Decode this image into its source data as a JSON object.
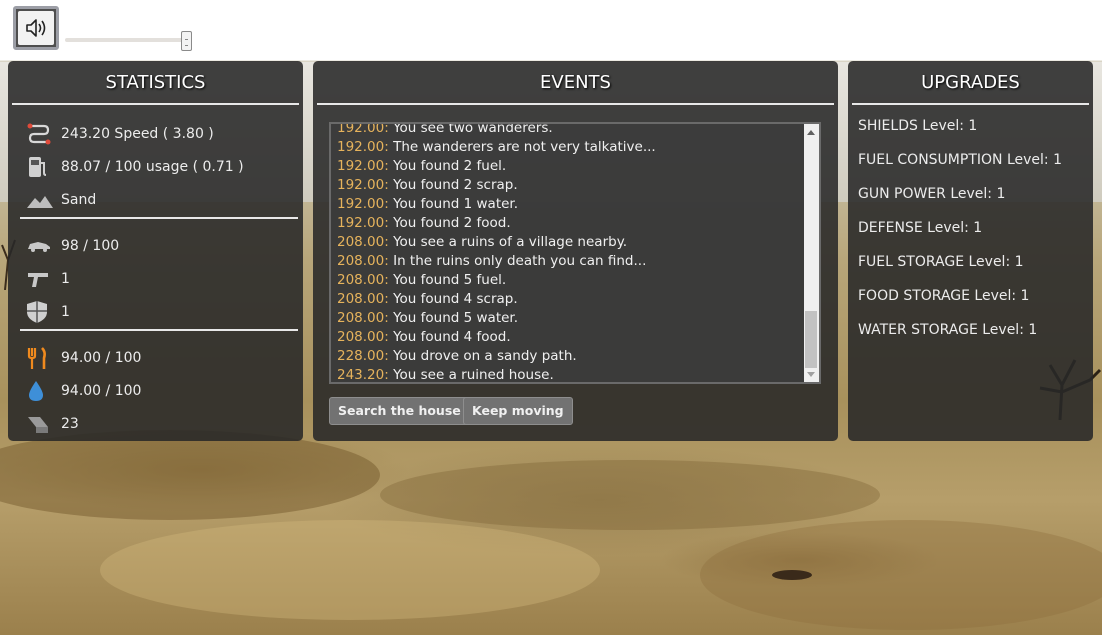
{
  "volume": {
    "level": 1.0
  },
  "statistics": {
    "title": "STATISTICS",
    "rows": [
      {
        "icon": "route-icon",
        "text": "243.20 Speed ( 3.80 )"
      },
      {
        "icon": "fuel-pump-icon",
        "text": "88.07 / 100 usage ( 0.71 )"
      },
      {
        "icon": "terrain-icon",
        "text": "Sand"
      },
      {
        "icon": "car-icon",
        "text": "98 / 100"
      },
      {
        "icon": "gun-icon",
        "text": "1"
      },
      {
        "icon": "shield-icon",
        "text": "1"
      },
      {
        "icon": "food-icon",
        "text": "94.00 / 100"
      },
      {
        "icon": "water-drop-icon",
        "text": "94.00 / 100"
      },
      {
        "icon": "scrap-icon",
        "text": "23"
      }
    ]
  },
  "events": {
    "title": "EVENTS",
    "log": [
      {
        "time": "192.00:",
        "msg": " You see two wanderers."
      },
      {
        "time": "192.00:",
        "msg": " The wanderers are not very talkative..."
      },
      {
        "time": "192.00:",
        "msg": " You found 2 fuel."
      },
      {
        "time": "192.00:",
        "msg": " You found 2 scrap."
      },
      {
        "time": "192.00:",
        "msg": " You found 1 water."
      },
      {
        "time": "192.00:",
        "msg": " You found 2 food."
      },
      {
        "time": "208.00:",
        "msg": " You see a ruins of a village nearby."
      },
      {
        "time": "208.00:",
        "msg": " In the ruins only death you can find..."
      },
      {
        "time": "208.00:",
        "msg": " You found 5 fuel."
      },
      {
        "time": "208.00:",
        "msg": " You found 4 scrap."
      },
      {
        "time": "208.00:",
        "msg": " You found 5 water."
      },
      {
        "time": "208.00:",
        "msg": " You found 4 food."
      },
      {
        "time": "228.00:",
        "msg": " You drove on a sandy path."
      },
      {
        "time": "243.20:",
        "msg": " You see a ruined house."
      }
    ],
    "actions": [
      "Search the house",
      "Keep moving"
    ]
  },
  "upgrades": {
    "title": "UPGRADES",
    "items": [
      "SHIELDS Level: 1",
      "FUEL CONSUMPTION Level: 1",
      "GUN POWER Level: 1",
      "DEFENSE Level: 1",
      "FUEL STORAGE Level: 1",
      "FOOD STORAGE Level: 1",
      "WATER STORAGE Level: 1"
    ]
  }
}
